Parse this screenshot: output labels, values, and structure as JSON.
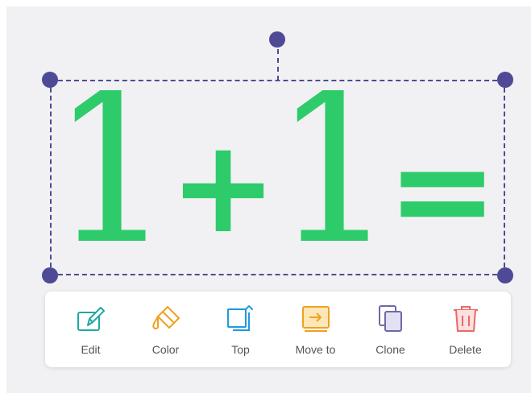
{
  "formula": {
    "first": "1",
    "operator": "+",
    "second": "1",
    "equals": "="
  },
  "colors": {
    "selection": "#4f4a96",
    "formula_text": "#2ecb6b",
    "edit": "#1fa8a0",
    "color": "#f0a020",
    "top": "#1e9be0",
    "move_to": "#f0a020",
    "clone": "#6c6aa8",
    "delete": "#e86a66"
  },
  "toolbar": {
    "items": [
      {
        "id": "edit",
        "label": "Edit",
        "icon": "pencil-icon"
      },
      {
        "id": "color",
        "label": "Color",
        "icon": "paint-bucket-icon"
      },
      {
        "id": "top",
        "label": "Top",
        "icon": "bring-to-top-icon"
      },
      {
        "id": "move_to",
        "label": "Move to",
        "icon": "move-to-icon"
      },
      {
        "id": "clone",
        "label": "Clone",
        "icon": "clone-icon"
      },
      {
        "id": "delete",
        "label": "Delete",
        "icon": "trash-icon"
      }
    ]
  }
}
